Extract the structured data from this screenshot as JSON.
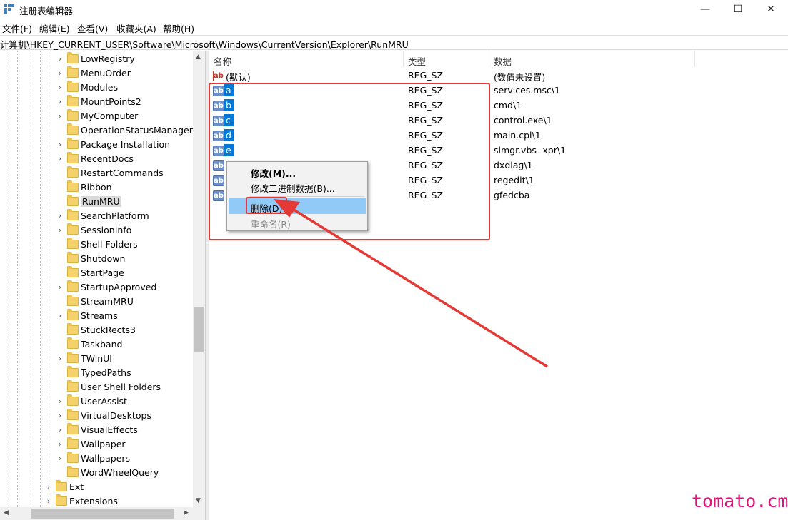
{
  "window": {
    "title": "注册表编辑器",
    "minimize_glyph": "—",
    "maximize_glyph": "☐",
    "close_glyph": "✕"
  },
  "menu": [
    "文件(F)",
    "编辑(E)",
    "查看(V)",
    "收藏夹(A)",
    "帮助(H)"
  ],
  "address": "计算机\\HKEY_CURRENT_USER\\Software\\Microsoft\\Windows\\CurrentVersion\\Explorer\\RunMRU",
  "tree": {
    "items": [
      {
        "label": "LowRegistry",
        "expandable": true
      },
      {
        "label": "MenuOrder",
        "expandable": true
      },
      {
        "label": "Modules",
        "expandable": true
      },
      {
        "label": "MountPoints2",
        "expandable": true
      },
      {
        "label": "MyComputer",
        "expandable": true
      },
      {
        "label": "OperationStatusManager",
        "expandable": false
      },
      {
        "label": "Package Installation",
        "expandable": true
      },
      {
        "label": "RecentDocs",
        "expandable": true
      },
      {
        "label": "RestartCommands",
        "expandable": false
      },
      {
        "label": "Ribbon",
        "expandable": false
      },
      {
        "label": "RunMRU",
        "expandable": false,
        "selected": true
      },
      {
        "label": "SearchPlatform",
        "expandable": true
      },
      {
        "label": "SessionInfo",
        "expandable": true
      },
      {
        "label": "Shell Folders",
        "expandable": false
      },
      {
        "label": "Shutdown",
        "expandable": false
      },
      {
        "label": "StartPage",
        "expandable": false
      },
      {
        "label": "StartupApproved",
        "expandable": true
      },
      {
        "label": "StreamMRU",
        "expandable": false
      },
      {
        "label": "Streams",
        "expandable": true
      },
      {
        "label": "StuckRects3",
        "expandable": false
      },
      {
        "label": "Taskband",
        "expandable": false
      },
      {
        "label": "TWinUI",
        "expandable": true
      },
      {
        "label": "TypedPaths",
        "expandable": false
      },
      {
        "label": "User Shell Folders",
        "expandable": false
      },
      {
        "label": "UserAssist",
        "expandable": true
      },
      {
        "label": "VirtualDesktops",
        "expandable": true
      },
      {
        "label": "VisualEffects",
        "expandable": true
      },
      {
        "label": "Wallpaper",
        "expandable": true
      },
      {
        "label": "Wallpapers",
        "expandable": true
      },
      {
        "label": "WordWheelQuery",
        "expandable": false
      },
      {
        "label": "Ext",
        "expandable": true,
        "level": "parent"
      },
      {
        "label": "Extensions",
        "expandable": true,
        "level": "parent"
      }
    ]
  },
  "columns": {
    "name": "名称",
    "type": "类型",
    "data": "数据"
  },
  "rows": [
    {
      "name": "(默认)",
      "type": "REG_SZ",
      "data": "(数值未设置)",
      "icon": "default",
      "selected": false
    },
    {
      "name": "a",
      "type": "REG_SZ",
      "data": "services.msc\\1",
      "icon": "sel",
      "selected": true
    },
    {
      "name": "b",
      "type": "REG_SZ",
      "data": "cmd\\1",
      "icon": "sel",
      "selected": true
    },
    {
      "name": "c",
      "type": "REG_SZ",
      "data": "control.exe\\1",
      "icon": "sel",
      "selected": true
    },
    {
      "name": "d",
      "type": "REG_SZ",
      "data": "main.cpl\\1",
      "icon": "sel",
      "selected": true
    },
    {
      "name": "e",
      "type": "REG_SZ",
      "data": "slmgr.vbs -xpr\\1",
      "icon": "sel",
      "selected": true
    },
    {
      "name": "",
      "type": "REG_SZ",
      "data": "dxdiag\\1",
      "icon": "sel",
      "selected": false
    },
    {
      "name": "",
      "type": "REG_SZ",
      "data": "regedit\\1",
      "icon": "sel",
      "selected": false
    },
    {
      "name": "",
      "type": "REG_SZ",
      "data": "gfedcba",
      "icon": "sel",
      "selected": false
    }
  ],
  "icon_text": "ab",
  "context_menu": {
    "modify": "修改(M)...",
    "modify_binary": "修改二进制数据(B)...",
    "delete": "删除(D)",
    "rename": "重命名(R)"
  },
  "colors": {
    "annotation_red": "#e53935",
    "selection_blue": "#0078d7",
    "menu_hover": "#91c9f7",
    "watermark": "#e2137a"
  },
  "watermark": "tomato.cm"
}
